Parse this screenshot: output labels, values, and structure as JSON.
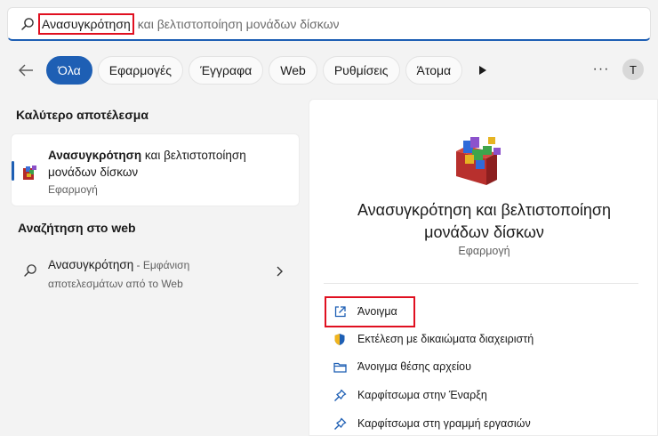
{
  "search": {
    "typed": "Ανασυγκρότηση",
    "suggestion": "και βελτιστοποίηση μονάδων δίσκων"
  },
  "filters": {
    "tabs": [
      "Όλα",
      "Εφαρμογές",
      "Έγγραφα",
      "Web",
      "Ρυθμίσεις",
      "Άτομα"
    ],
    "avatar_initial": "T",
    "more_label": "···"
  },
  "best_match": {
    "section_title": "Καλύτερο αποτέλεσμα",
    "title_bold": "Ανασυγκρότηση",
    "title_rest": " και βελτιστοποίηση μονάδων δίσκων",
    "subtitle": "Εφαρμογή"
  },
  "web_search": {
    "section_title": "Αναζήτηση στο web",
    "query": "Ανασυγκρότηση",
    "hint_line1": " - Εμφάνιση",
    "hint_line2": "αποτελεσμάτων από το Web"
  },
  "detail": {
    "title": "Ανασυγκρότηση και βελτιστοποίηση μονάδων δίσκων",
    "type": "Εφαρμογή",
    "actions": [
      {
        "label": "Άνοιγμα",
        "icon": "open-external-icon"
      },
      {
        "label": "Εκτέλεση με δικαιώματα διαχειριστή",
        "icon": "shield-icon"
      },
      {
        "label": "Άνοιγμα θέσης αρχείου",
        "icon": "folder-icon"
      },
      {
        "label": "Καρφίτσωμα στην Έναρξη",
        "icon": "pin-icon"
      },
      {
        "label": "Καρφίτσωμα στη γραμμή εργασιών",
        "icon": "pin-icon"
      }
    ]
  },
  "colors": {
    "accent": "#1e5fb4",
    "highlight_box": "#e01020",
    "background": "#f3f3f3"
  }
}
